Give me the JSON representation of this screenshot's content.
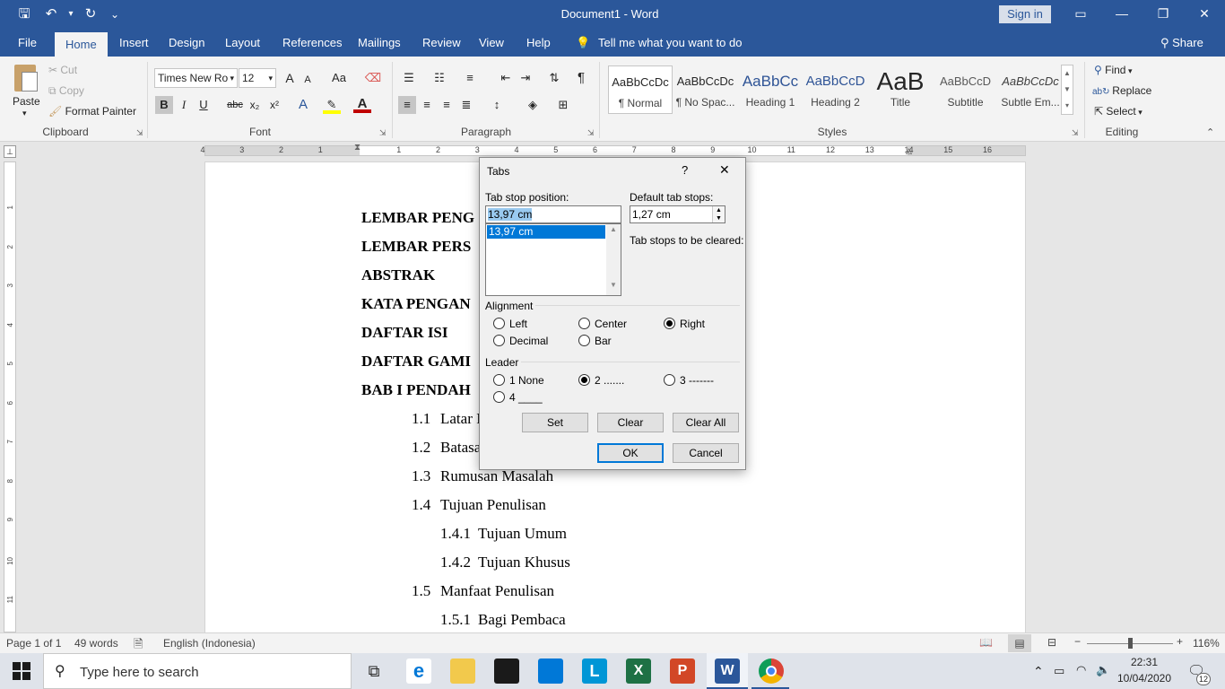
{
  "window": {
    "title": "Document1 - Word",
    "signin": "Sign in"
  },
  "qat": {
    "save": "🖫",
    "undo": "↶",
    "undo_dd": "▾",
    "redo": "↻",
    "customize": "⌄"
  },
  "menu": {
    "file": "File",
    "home": "Home",
    "insert": "Insert",
    "design": "Design",
    "layout": "Layout",
    "references": "References",
    "mailings": "Mailings",
    "review": "Review",
    "view": "View",
    "help": "Help",
    "tell_me": "Tell me what you want to do",
    "share": "Share"
  },
  "ribbon": {
    "clipboard": {
      "label": "Clipboard",
      "paste": "Paste",
      "cut": "Cut",
      "copy": "Copy",
      "format_painter": "Format Painter"
    },
    "font": {
      "label": "Font",
      "name": "Times New Ro",
      "size": "12",
      "bold": "B",
      "italic": "I",
      "underline": "U",
      "strike": "abc",
      "sub": "x₂",
      "sup": "x²",
      "grow": "A",
      "shrink": "A",
      "case": "Aa"
    },
    "paragraph": {
      "label": "Paragraph",
      "pilcrow": "¶"
    },
    "styles": {
      "label": "Styles",
      "items": [
        {
          "preview": "AaBbCcDc",
          "name": "¶ Normal"
        },
        {
          "preview": "AaBbCcDc",
          "name": "¶ No Spac..."
        },
        {
          "preview": "AaBbCc",
          "name": "Heading 1"
        },
        {
          "preview": "AaBbCcD",
          "name": "Heading 2"
        },
        {
          "preview": "AaB",
          "name": "Title"
        },
        {
          "preview": "AaBbCcD",
          "name": "Subtitle"
        },
        {
          "preview": "AaBbCcDc",
          "name": "Subtle Em..."
        }
      ]
    },
    "editing": {
      "label": "Editing",
      "find": "Find",
      "replace": "Replace",
      "select": "Select"
    }
  },
  "ruler": {
    "ticks": [
      "4",
      "3",
      "2",
      "1",
      "1",
      "2",
      "3",
      "4",
      "5",
      "6",
      "7",
      "8",
      "9",
      "10",
      "11",
      "12",
      "13",
      "14",
      "15",
      "16"
    ]
  },
  "vruler": {
    "ticks": [
      "1",
      "2",
      "3",
      "4",
      "5",
      "6",
      "7",
      "8",
      "9",
      "10",
      "11"
    ]
  },
  "document": {
    "lines": [
      {
        "text": "LEMBAR PENG",
        "bold": true
      },
      {
        "text": "LEMBAR PERS",
        "bold": true
      },
      {
        "text": "ABSTRAK",
        "bold": true
      },
      {
        "text": "KATA PENGAN",
        "bold": true
      },
      {
        "text": "DAFTAR ISI",
        "bold": true
      },
      {
        "text": "DAFTAR GAMI",
        "bold": true
      },
      {
        "text": "BAB I PENDAH",
        "bold": true
      },
      {
        "num": "1.1",
        "text": "Latar I"
      },
      {
        "num": "1.2",
        "text": "Batasa"
      },
      {
        "num": "1.3",
        "text": "Rumusan Masalah"
      },
      {
        "num": "1.4",
        "text": "Tujuan Penulisan"
      },
      {
        "num": "1.4.1",
        "text": "Tujuan Umum",
        "sub": true
      },
      {
        "num": "1.4.2",
        "text": "Tujuan Khusus",
        "sub": true
      },
      {
        "num": "1.5",
        "text": "Manfaat Penulisan"
      },
      {
        "num": "1.5.1",
        "text": "Bagi Pembaca",
        "sub": true
      }
    ]
  },
  "dialog": {
    "title": "Tabs",
    "help": "?",
    "close": "✕",
    "tab_stop_label": "Tab stop position:",
    "tab_stop_value": "13,97 cm",
    "list_items": [
      "13,97 cm"
    ],
    "default_label": "Default tab stops:",
    "default_value": "1,27 cm",
    "cleared_label": "Tab stops to be cleared:",
    "alignment_label": "Alignment",
    "alignment": [
      "Left",
      "Center",
      "Right",
      "Decimal",
      "Bar"
    ],
    "alignment_selected": "Right",
    "leader_label": "Leader",
    "leader": [
      "1 None",
      "2 .......",
      "3 -------",
      "4 ____"
    ],
    "leader_selected": "2 .......",
    "set": "Set",
    "clear": "Clear",
    "clear_all": "Clear All",
    "ok": "OK",
    "cancel": "Cancel"
  },
  "status": {
    "page": "Page 1 of 1",
    "words": "49 words",
    "language": "English (Indonesia)",
    "zoom": "116%"
  },
  "taskbar": {
    "search_placeholder": "Type here to search",
    "time": "22:31",
    "date": "10/04/2020",
    "notif_count": "12"
  }
}
